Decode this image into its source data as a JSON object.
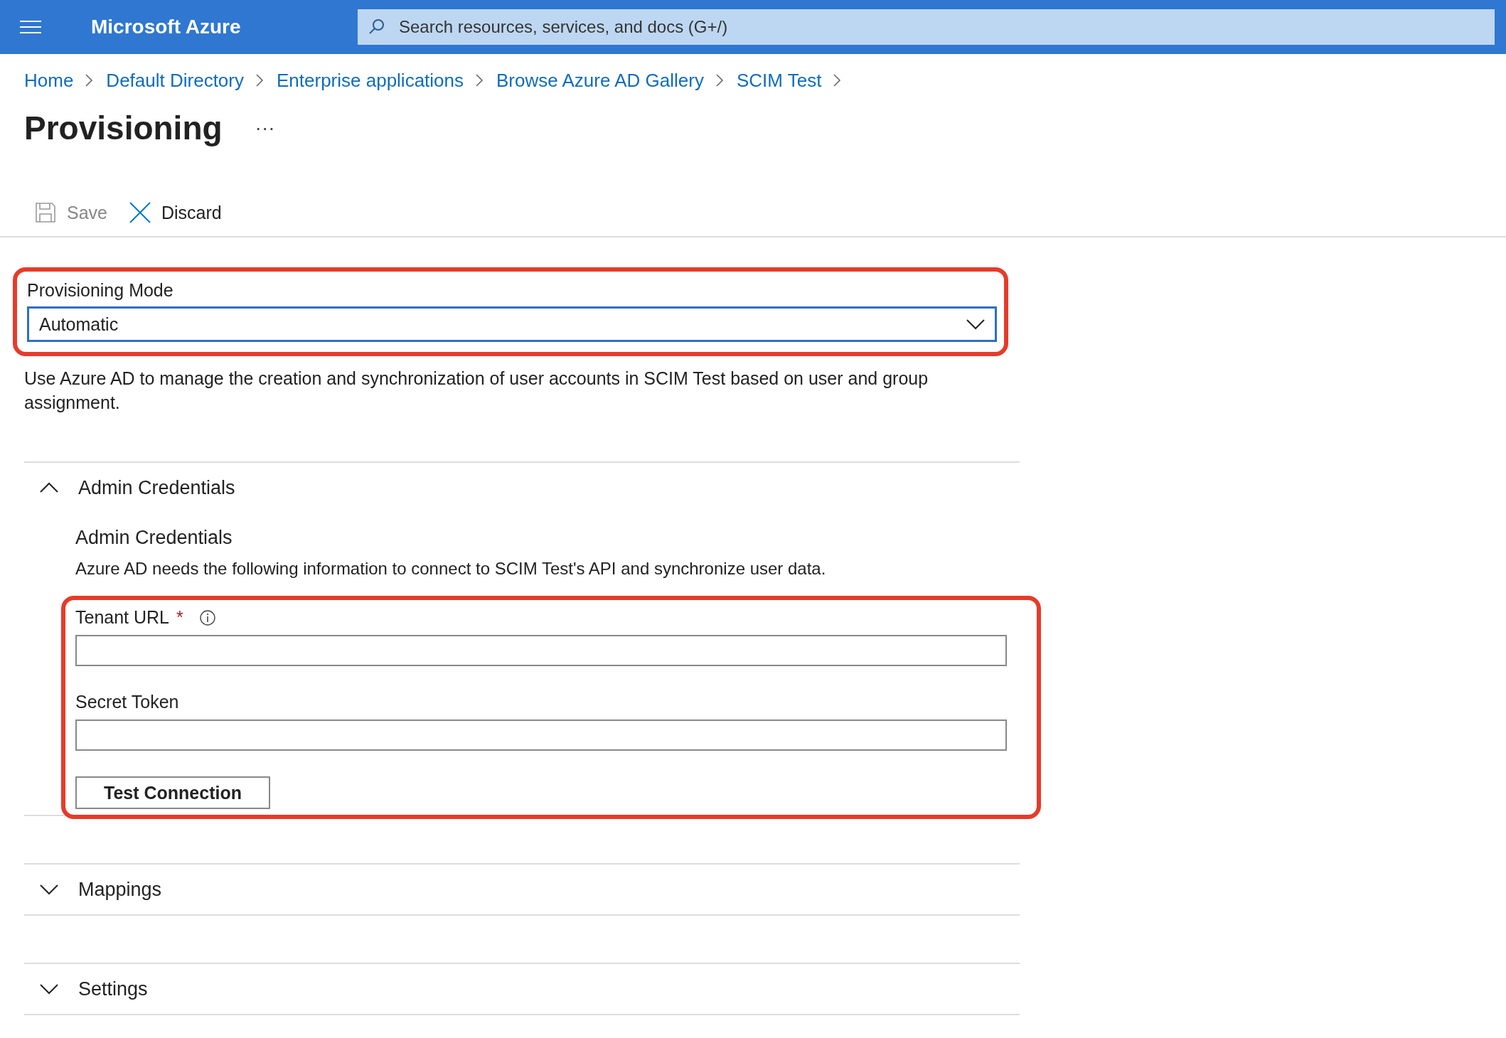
{
  "header": {
    "brand": "Microsoft Azure",
    "search_placeholder": "Search resources, services, and docs (G+/)"
  },
  "breadcrumb": [
    "Home",
    "Default Directory",
    "Enterprise applications",
    "Browse Azure AD Gallery",
    "SCIM Test"
  ],
  "page_title": "Provisioning",
  "more": "···",
  "toolbar": [
    {
      "kind": "save",
      "label": "Save",
      "disabled": true
    },
    {
      "kind": "discard",
      "label": "Discard",
      "disabled": false
    }
  ],
  "provisioning_mode": {
    "label": "Provisioning Mode",
    "value": "Automatic",
    "highlighted": true
  },
  "description": "Use Azure AD to manage the creation and synchronization of user accounts in SCIM Test based on user and group assignment.",
  "sections": [
    {
      "title": "Admin Credentials",
      "expanded": true,
      "subtitle": "Admin Credentials",
      "description": "Azure AD needs the following information to connect to SCIM Test's API and synchronize user data.",
      "highlighted": true,
      "fields": [
        {
          "label": "Tenant URL",
          "required_mark": "*",
          "info": true
        },
        {
          "label": "Secret Token",
          "info": false
        }
      ],
      "button": "Test Connection"
    },
    {
      "title": "Mappings",
      "expanded": false
    },
    {
      "title": "Settings",
      "expanded": false
    }
  ]
}
